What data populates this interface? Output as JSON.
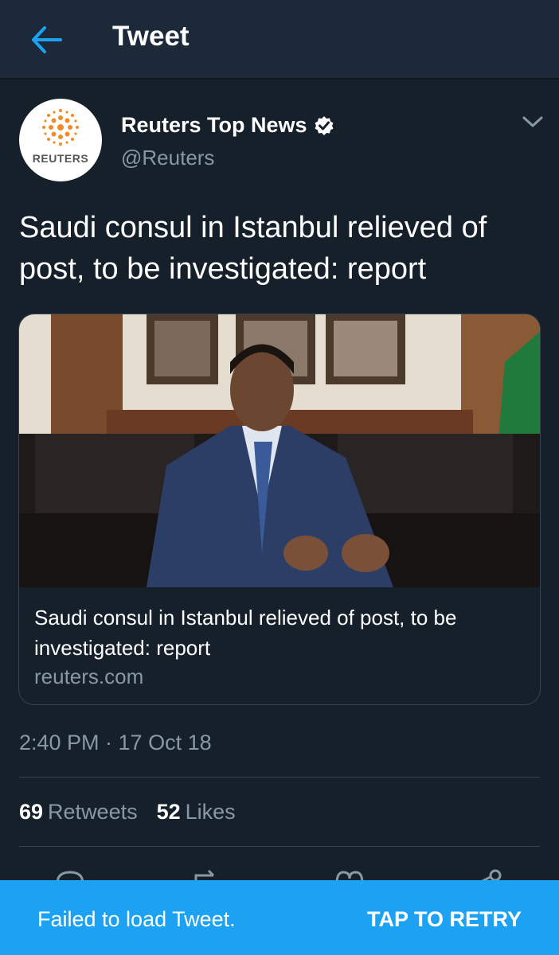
{
  "header": {
    "title": "Tweet",
    "back_icon": "arrow-left-icon"
  },
  "colors": {
    "background": "#15202b",
    "header": "#1c2938",
    "accent": "#1da1f2",
    "secondary_text": "#8899a6"
  },
  "author": {
    "avatar_text": "REUTERS",
    "name": "Reuters Top News",
    "verified_icon": "verified-badge-icon",
    "handle": "@Reuters"
  },
  "tweet": {
    "text": "Saudi consul in Istanbul relieved of post, to be investigated: report"
  },
  "card": {
    "image_icon": "news-photo",
    "title": "Saudi consul in Istanbul relieved of post, to be investigated: report",
    "domain": "reuters.com"
  },
  "timestamp": "2:40 PM · 17 Oct 18",
  "stats": {
    "retweets_count": "69",
    "retweets_label": "Retweets",
    "likes_count": "52",
    "likes_label": "Likes"
  },
  "snackbar": {
    "message": "Failed to load Tweet.",
    "action": "TAP TO RETRY"
  }
}
